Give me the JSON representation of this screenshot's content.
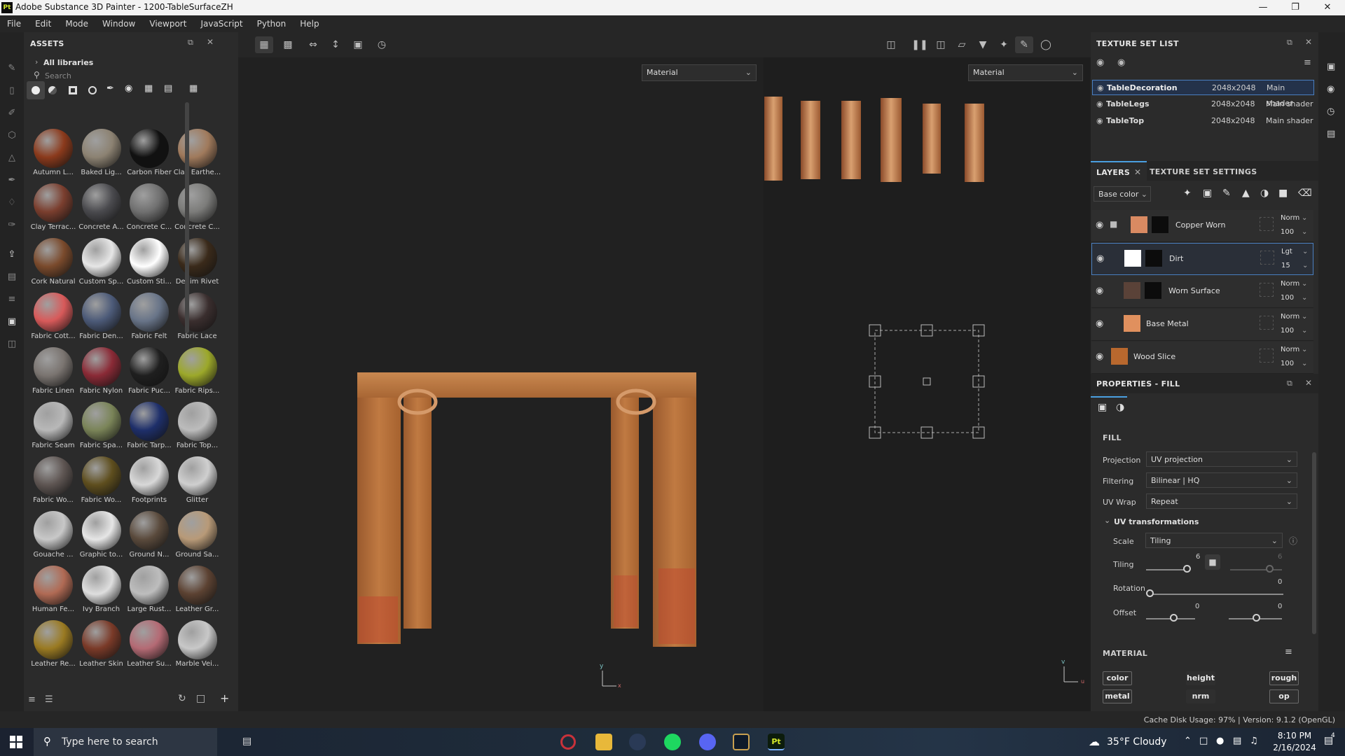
{
  "window": {
    "title": "Adobe Substance 3D Painter - 1200-TableSurfaceZH",
    "app_icon": "Pt"
  },
  "menu": [
    "File",
    "Edit",
    "Mode",
    "Window",
    "Viewport",
    "JavaScript",
    "Python",
    "Help"
  ],
  "assets": {
    "title": "ASSETS",
    "breadcrumb": "All libraries",
    "search_placeholder": "Search",
    "materials": [
      {
        "name": "Autumn L...",
        "color": "#8b3a1c"
      },
      {
        "name": "Baked Lig...",
        "color": "#8c8272"
      },
      {
        "name": "Carbon Fiber",
        "color": "#111111"
      },
      {
        "name": "Clay Earthe...",
        "color": "#a07a5c"
      },
      {
        "name": "Clay Terrac...",
        "color": "#7a3e2e"
      },
      {
        "name": "Concrete A...",
        "color": "#4a4a4e"
      },
      {
        "name": "Concrete C...",
        "color": "#707070"
      },
      {
        "name": "Concrete C...",
        "color": "#7c7c7a"
      },
      {
        "name": "Cork Natural",
        "color": "#7a4a2c"
      },
      {
        "name": "Custom Sp...",
        "color": "#e6e6e6"
      },
      {
        "name": "Custom Sti...",
        "color": "#ffffff"
      },
      {
        "name": "Denim Rivet",
        "color": "#3a2a1a"
      },
      {
        "name": "Fabric Cott...",
        "color": "#d85a5a"
      },
      {
        "name": "Fabric Den...",
        "color": "#4c5a78"
      },
      {
        "name": "Fabric Felt",
        "color": "#687488"
      },
      {
        "name": "Fabric Lace",
        "color": "#3a2e2e"
      },
      {
        "name": "Fabric Linen",
        "color": "#7a7470"
      },
      {
        "name": "Fabric Nylon",
        "color": "#8a2a36"
      },
      {
        "name": "Fabric Puc...",
        "color": "#1f1f1f"
      },
      {
        "name": "Fabric Rips...",
        "color": "#9ca82a"
      },
      {
        "name": "Fabric Seam",
        "color": "#b8b8b8"
      },
      {
        "name": "Fabric Spa...",
        "color": "#7a8458"
      },
      {
        "name": "Fabric Tarp...",
        "color": "#1e2f6a"
      },
      {
        "name": "Fabric Top...",
        "color": "#bcbcbc"
      },
      {
        "name": "Fabric Wo...",
        "color": "#5e5552"
      },
      {
        "name": "Fabric Wo...",
        "color": "#5e4e1e"
      },
      {
        "name": "Footprints",
        "color": "#d8d8d8"
      },
      {
        "name": "Glitter",
        "color": "#cfcfcf"
      },
      {
        "name": "Gouache ...",
        "color": "#c8c8c8"
      },
      {
        "name": "Graphic to...",
        "color": "#e6e6e6"
      },
      {
        "name": "Ground N...",
        "color": "#5a4a3c"
      },
      {
        "name": "Ground Sa...",
        "color": "#b89a78"
      },
      {
        "name": "Human Fe...",
        "color": "#b06a54"
      },
      {
        "name": "Ivy Branch",
        "color": "#dedede"
      },
      {
        "name": "Large Rust...",
        "color": "#bdbdbd"
      },
      {
        "name": "Leather Gr...",
        "color": "#5c4232"
      },
      {
        "name": "Leather Re...",
        "color": "#9a7a22"
      },
      {
        "name": "Leather Skin",
        "color": "#7a3a28"
      },
      {
        "name": "Leather Su...",
        "color": "#b46a74"
      },
      {
        "name": "Marble Vei...",
        "color": "#c8c8c8"
      }
    ]
  },
  "viewport": {
    "left_mode": "Material",
    "right_mode": "Material"
  },
  "texture_set_list": {
    "title": "TEXTURE SET LIST",
    "rows": [
      {
        "name": "TableDecoration",
        "size": "2048x2048",
        "shader": "Main shader"
      },
      {
        "name": "TableLegs",
        "size": "2048x2048",
        "shader": "Main shader"
      },
      {
        "name": "TableTop",
        "size": "2048x2048",
        "shader": "Main shader"
      }
    ]
  },
  "layers": {
    "tab_layers": "LAYERS",
    "tab_settings": "TEXTURE SET SETTINGS",
    "channel": "Base color",
    "items": [
      {
        "name": "Copper Worn",
        "blend": "Norm",
        "opacity": "100",
        "color": "#d98a62"
      },
      {
        "name": "Dirt",
        "blend": "Lgt",
        "opacity": "15",
        "color": "#ffffff"
      },
      {
        "name": "Worn Surface",
        "blend": "Norm",
        "opacity": "100",
        "color": "#5a4238"
      },
      {
        "name": "Base Metal",
        "blend": "Norm",
        "opacity": "100",
        "color": "#e0905e"
      },
      {
        "name": "Wood Slice",
        "blend": "Norm",
        "opacity": "100",
        "color": "#b8682e"
      }
    ]
  },
  "properties": {
    "title": "PROPERTIES - FILL",
    "section": "FILL",
    "projection_label": "Projection",
    "projection_value": "UV projection",
    "filtering_label": "Filtering",
    "filtering_value": "Bilinear | HQ",
    "uvwrap_label": "UV Wrap",
    "uvwrap_value": "Repeat",
    "uvtrans_label": "UV transformations",
    "scale_label": "Scale",
    "scale_value": "Tiling",
    "tiling_label": "Tiling",
    "tiling_u": "6",
    "tiling_v": "6",
    "rotation_label": "Rotation",
    "rotation_value": "0",
    "offset_label": "Offset",
    "offset_u": "0",
    "offset_v": "0",
    "material_label": "MATERIAL",
    "channels": [
      "color",
      "height",
      "rough",
      "metal",
      "nrm",
      "op"
    ]
  },
  "status": {
    "text": "Cache Disk Usage:  97% | Version: 9.1.2 (OpenGL)"
  },
  "taskbar": {
    "search": "Type here to search",
    "weather": "35°F  Cloudy",
    "time": "8:10 PM",
    "date": "2/16/2024",
    "notif": "4"
  }
}
